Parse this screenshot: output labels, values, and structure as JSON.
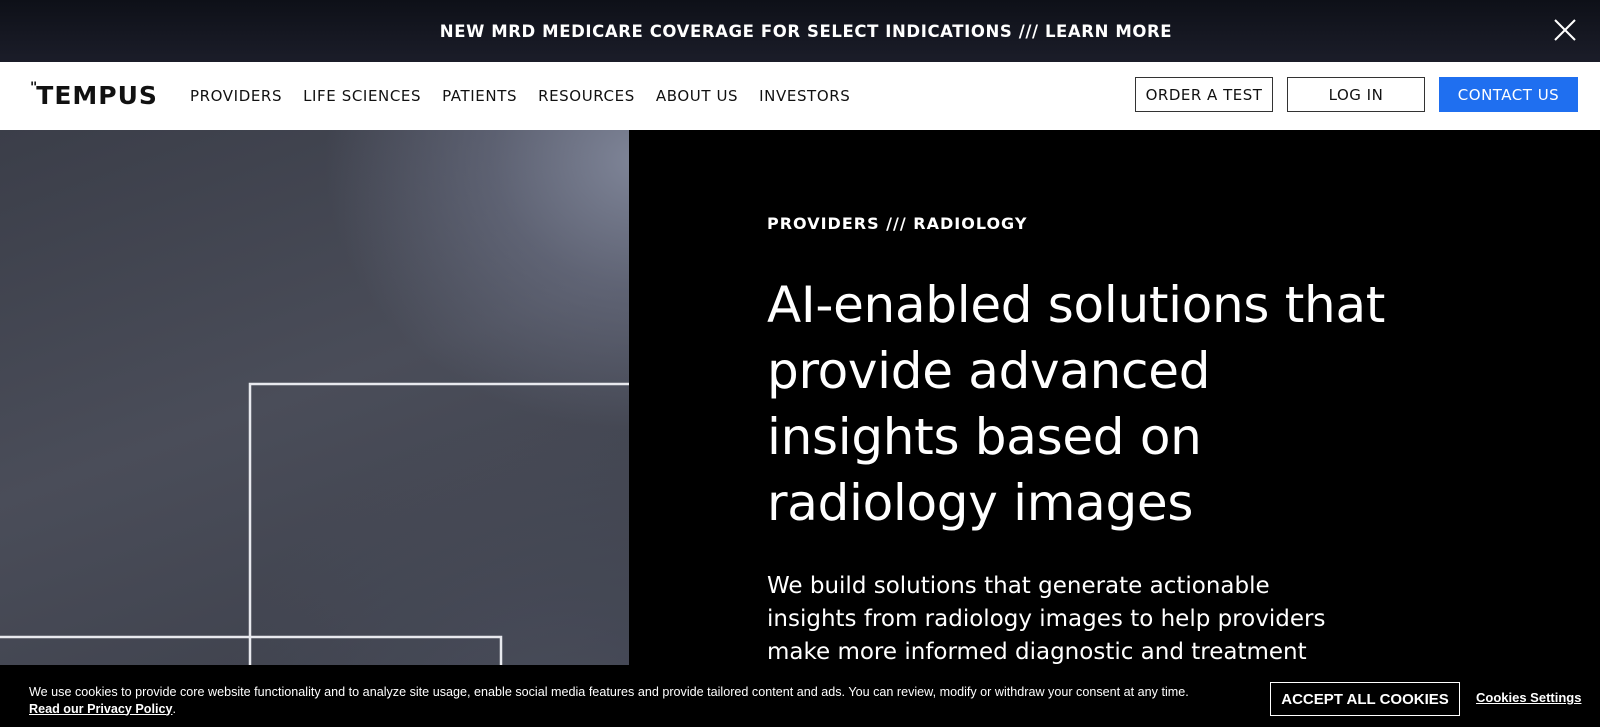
{
  "banner": {
    "text": "NEW MRD MEDICARE COVERAGE FOR SELECT INDICATIONS /// LEARN MORE",
    "close_icon": "close-icon"
  },
  "nav": {
    "logo_text": "TEMPUS",
    "logo_marks": "\"",
    "links": [
      "PROVIDERS",
      "LIFE SCIENCES",
      "PATIENTS",
      "RESOURCES",
      "ABOUT US",
      "INVESTORS"
    ],
    "buttons": {
      "order": "ORDER A TEST",
      "login": "LOG IN",
      "contact": "CONTACT US"
    },
    "contact_color": "#1f6ff0"
  },
  "hero": {
    "eyebrow": "PROVIDERS /// RADIOLOGY",
    "headline": "AI-enabled solutions that provide advanced insights based on radiology images",
    "subcopy": "We build solutions that generate actionable insights from radiology images to help providers make more informed diagnostic and treatment"
  },
  "cookie": {
    "text": "We use cookies to provide core website functionality and to analyze site usage, enable social media features and provide tailored content and ads. You can review, modify or withdraw your consent at any time.",
    "privacy_link": "Read our Privacy Policy",
    "privacy_suffix": ".",
    "accept_label": "ACCEPT ALL COOKIES",
    "settings_label": "Cookies Settings"
  }
}
